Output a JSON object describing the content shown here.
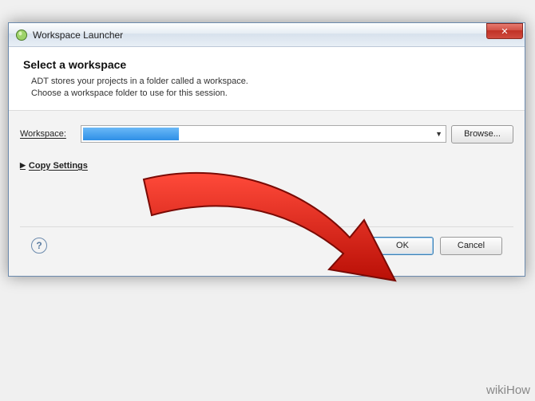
{
  "titlebar": {
    "title": "Workspace Launcher",
    "close_glyph": "✕"
  },
  "header": {
    "heading": "Select a workspace",
    "line1": "ADT stores your projects in a folder called a workspace.",
    "line2": "Choose a workspace folder to use for this session."
  },
  "form": {
    "workspace_label": "Workspace:",
    "workspace_value": "",
    "browse_label": "Browse...",
    "copy_settings_label": "Copy Settings"
  },
  "footer": {
    "help_glyph": "?",
    "ok_label": "OK",
    "cancel_label": "Cancel"
  },
  "watermark": "wikiHow"
}
